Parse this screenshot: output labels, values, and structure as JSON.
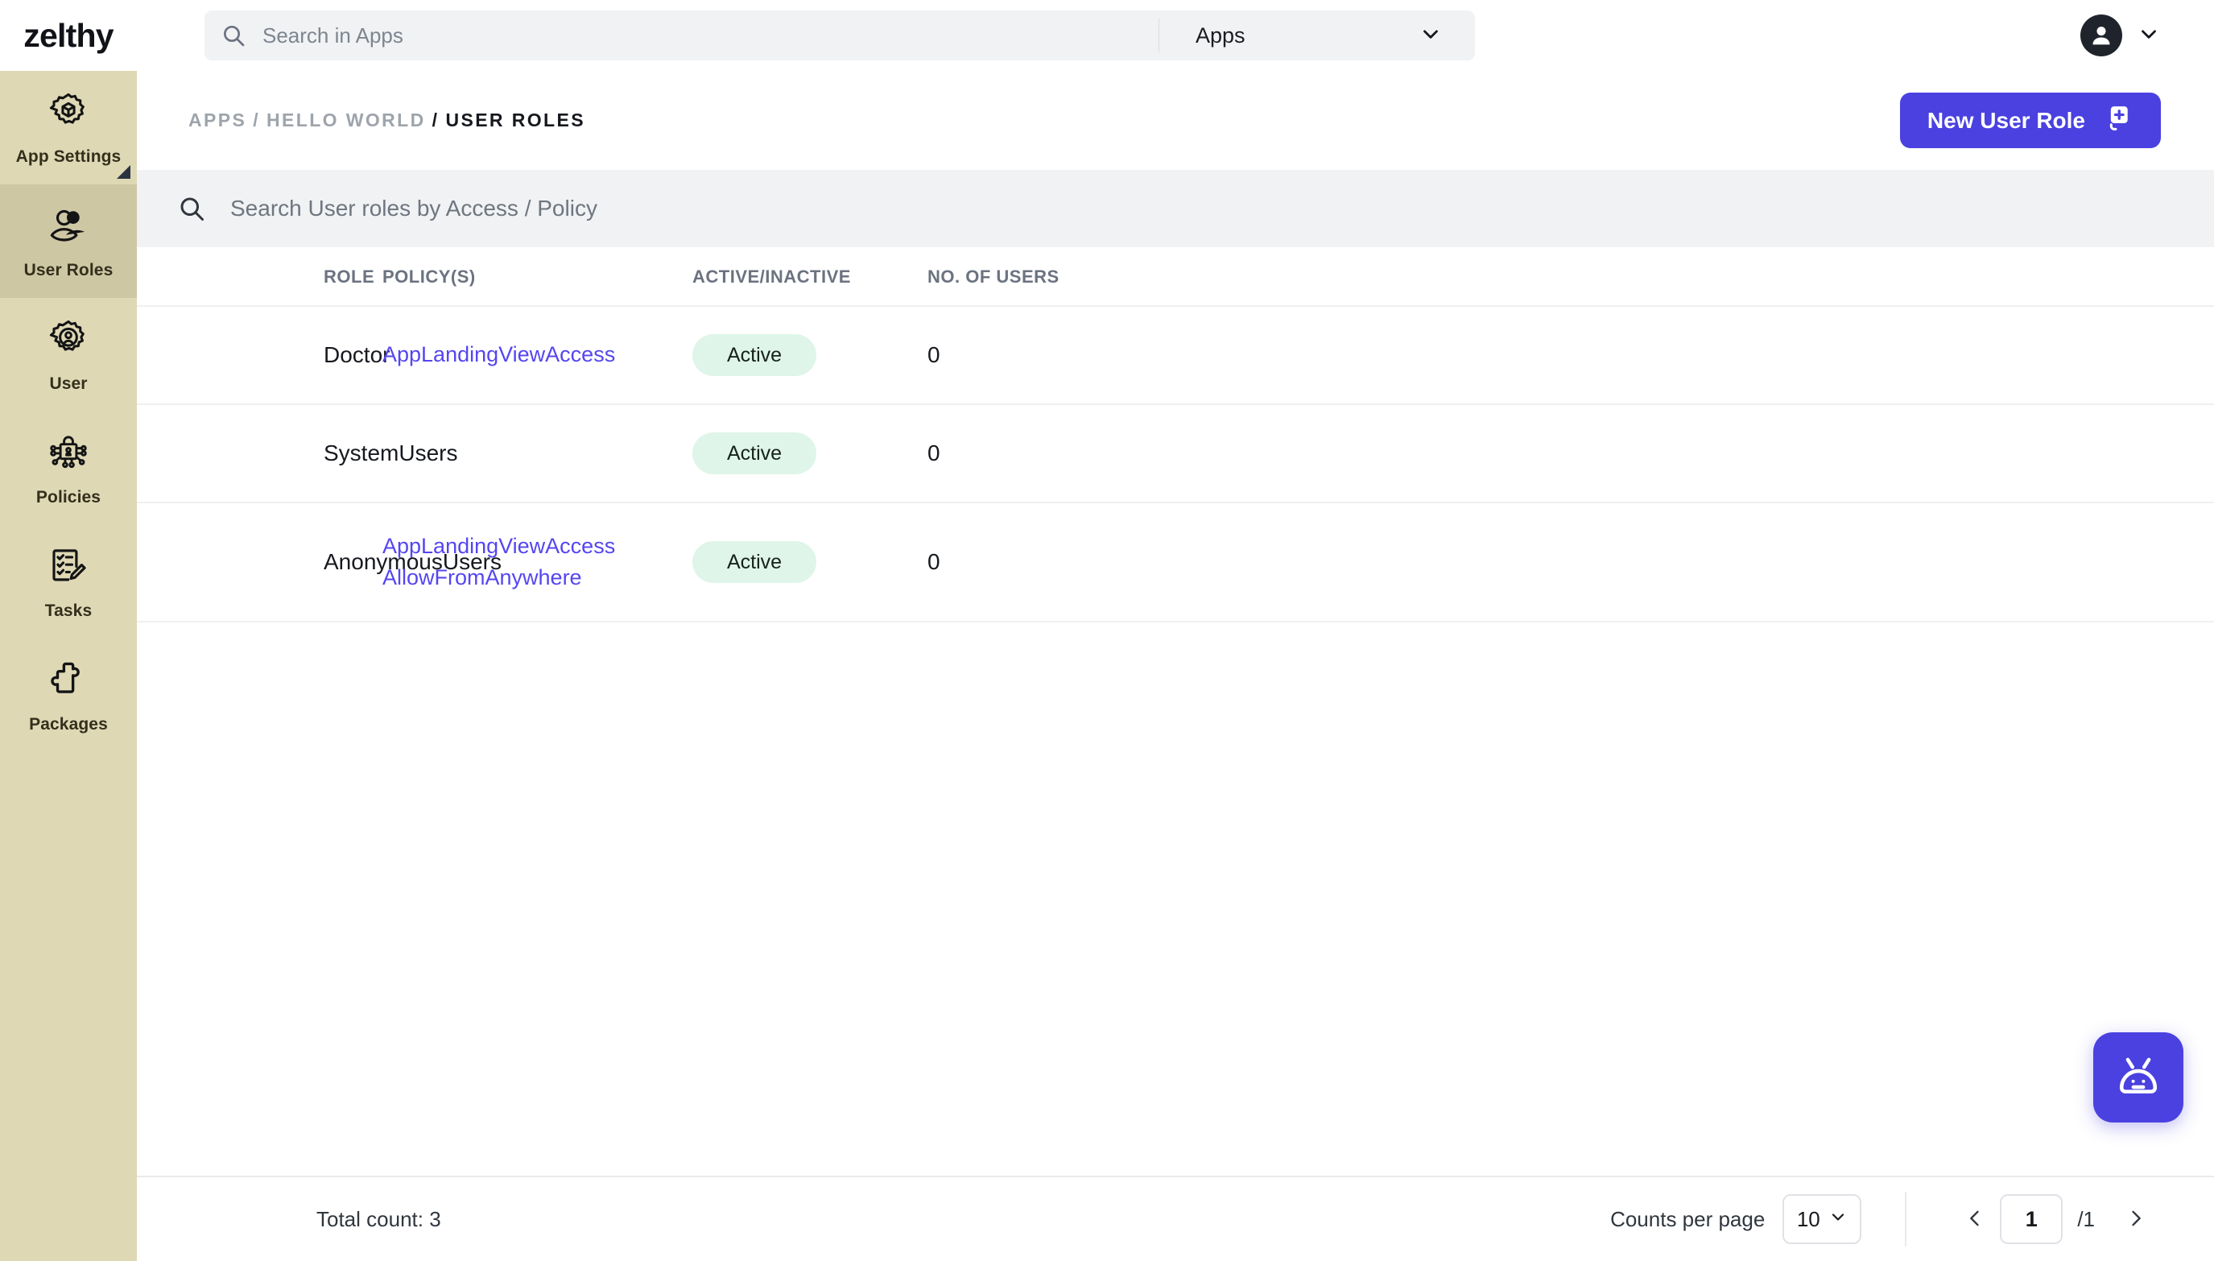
{
  "brand": {
    "logo_text": "zelthy"
  },
  "topbar": {
    "search": {
      "placeholder": "Search in Apps",
      "value": ""
    },
    "scope_select": {
      "label": "Apps",
      "icon": "chevron-down-icon"
    },
    "avatar": {
      "icon": "user-avatar-icon",
      "chevron": "chevron-down-icon"
    }
  },
  "sidebar": {
    "items": [
      {
        "label": "App Settings",
        "icon": "gear-cube-icon",
        "active": false,
        "marker": true
      },
      {
        "label": "User Roles",
        "icon": "users-icon",
        "active": true,
        "marker": false
      },
      {
        "label": "User",
        "icon": "gear-user-icon",
        "active": false,
        "marker": false
      },
      {
        "label": "Policies",
        "icon": "lock-network-icon",
        "active": false,
        "marker": false
      },
      {
        "label": "Tasks",
        "icon": "checklist-pencil-icon",
        "active": false,
        "marker": false
      },
      {
        "label": "Packages",
        "icon": "puzzle-piece-icon",
        "active": false,
        "marker": false
      }
    ]
  },
  "page": {
    "breadcrumb": [
      {
        "text": "APPS",
        "current": false
      },
      {
        "text": "HELLO WORLD",
        "current": false
      },
      {
        "text": "USER ROLES",
        "current": true
      }
    ],
    "separator": "/",
    "new_button": {
      "label": "New User Role",
      "icon": "add-document-icon"
    }
  },
  "table_search": {
    "placeholder": "Search User roles by Access / Policy",
    "value": "",
    "icon": "search-icon"
  },
  "table": {
    "columns": [
      "ROLE",
      "POLICY(S)",
      "ACTIVE/INACTIVE",
      "NO. OF USERS"
    ],
    "rows": [
      {
        "role": "Doctor",
        "policies": [
          "AppLandingViewAccess"
        ],
        "status": "Active",
        "users": "0"
      },
      {
        "role": "SystemUsers",
        "policies": [],
        "status": "Active",
        "users": "0"
      },
      {
        "role": "AnonymousUsers",
        "policies": [
          "AppLandingViewAccess",
          "AllowFromAnywhere"
        ],
        "status": "Active",
        "users": "0"
      }
    ]
  },
  "footer": {
    "total_count": "Total count: 3",
    "counts_per_page_label": "Counts per page",
    "counts_per_page_value": "10",
    "prev_icon": "chevron-left-icon",
    "next_icon": "chevron-right-icon",
    "current_page": "1",
    "total_pages": "/1"
  },
  "fab": {
    "icon": "chat-bot-icon"
  },
  "colors": {
    "accent": "#4a41e0",
    "link": "#5546f0",
    "sidebar_bg": "#ded8b5",
    "sidebar_active": "#cdc7a4",
    "badge_bg": "#dff5ea",
    "search_bg": "#f1f2f4"
  }
}
